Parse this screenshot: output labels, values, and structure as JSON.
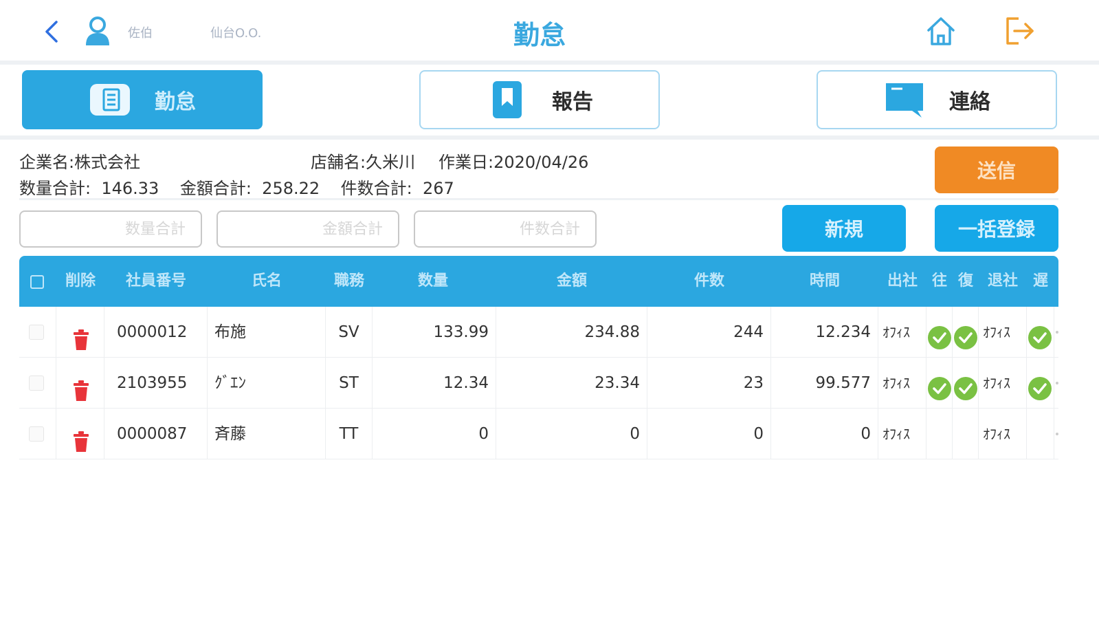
{
  "header": {
    "user_name": "佐伯",
    "store_name": "仙台O.O.",
    "title": "勤怠"
  },
  "tabs": [
    {
      "label": "勤怠",
      "icon": "list-icon",
      "active": true
    },
    {
      "label": "報告",
      "icon": "bookmark-icon",
      "active": false
    },
    {
      "label": "連絡",
      "icon": "message-icon",
      "active": false
    }
  ],
  "info": {
    "company": "企業名:株式会社",
    "store": "店舗名:久米川",
    "work_date": "作業日:2020/04/26",
    "totals": "数量合計:  146.33    金額合計:  258.22    件数合計:  267"
  },
  "send_label": "送信",
  "filters": {
    "qty_placeholder": "数量合計",
    "amount_placeholder": "金額合計",
    "count_placeholder": "件数合計"
  },
  "new_label": "新規",
  "bulk_label": "一括登録",
  "table": {
    "headers": {
      "delete": "削除",
      "emp_no": "社員番号",
      "name": "氏名",
      "role": "職務",
      "qty": "数量",
      "amount": "金額",
      "count": "件数",
      "time": "時間",
      "in": "出社",
      "go": "往",
      "back": "復",
      "out": "退社",
      "late": "遅"
    },
    "rows": [
      {
        "emp_no": "0000012",
        "name": "布施",
        "role": "SV",
        "qty": "133.99",
        "amount": "234.88",
        "count": "244",
        "time": "12.234",
        "in": "ｵﾌｨｽ",
        "go_ok": true,
        "back_ok": true,
        "out": "ｵﾌｨｽ",
        "late_ok": true
      },
      {
        "emp_no": "2103955",
        "name": "ｸﾞｴﾝ",
        "role": "ST",
        "qty": "12.34",
        "amount": "23.34",
        "count": "23",
        "time": "99.577",
        "in": "ｵﾌｨｽ",
        "go_ok": true,
        "back_ok": true,
        "out": "ｵﾌｨｽ",
        "late_ok": true
      },
      {
        "emp_no": "0000087",
        "name": "斉藤",
        "role": "TT",
        "qty": "0",
        "amount": "0",
        "count": "0",
        "time": "0",
        "in": "ｵﾌｨｽ",
        "go_ok": false,
        "back_ok": false,
        "out": "ｵﾌｨｽ",
        "late_ok": false
      }
    ]
  },
  "colors": {
    "primary": "#2ba7e0",
    "send": "#f08a24",
    "delete": "#e8343a",
    "ok": "#7ac143"
  }
}
